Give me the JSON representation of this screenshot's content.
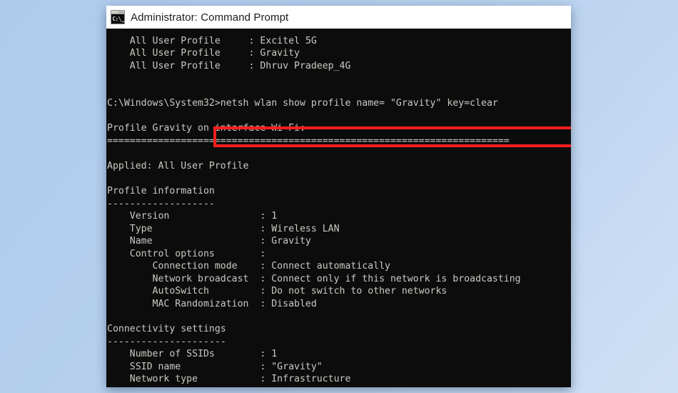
{
  "desktop": {
    "background_top_color": "#aecbea",
    "background_bottom_color": "#cfe0f5"
  },
  "window": {
    "title": "Administrator: Command Prompt",
    "icon": "command-prompt-icon",
    "icon_glyph": "C:\\_",
    "background_color": "#0c0c0c",
    "text_color": "#ccc9c2"
  },
  "annotation": {
    "type": "rectangle-highlight",
    "color": "#f71e1e",
    "targets_line": "C:\\Windows\\System32>netsh wlan show profile name= \"Gravity\" key=clear"
  },
  "console": {
    "prompt": "C:\\Windows\\System32>",
    "command": "netsh wlan show profile name= \"Gravity\" key=clear",
    "lines": [
      "------------",
      "    All User Profile     : Excitel 5G",
      "    All User Profile     : Gravity",
      "    All User Profile     : Dhruv Pradeep_4G",
      "",
      "",
      "C:\\Windows\\System32>netsh wlan show profile name= \"Gravity\" key=clear",
      "",
      "Profile Gravity on interface Wi-Fi:",
      "=======================================================================",
      "",
      "Applied: All User Profile",
      "",
      "Profile information",
      "-------------------",
      "    Version                : 1",
      "    Type                   : Wireless LAN",
      "    Name                   : Gravity",
      "    Control options        :",
      "        Connection mode    : Connect automatically",
      "        Network broadcast  : Connect only if this network is broadcasting",
      "        AutoSwitch         : Do not switch to other networks",
      "        MAC Randomization  : Disabled",
      "",
      "Connectivity settings",
      "---------------------",
      "    Number of SSIDs        : 1",
      "    SSID name              : \"Gravity\"",
      "    Network type           : Infrastructure"
    ]
  }
}
